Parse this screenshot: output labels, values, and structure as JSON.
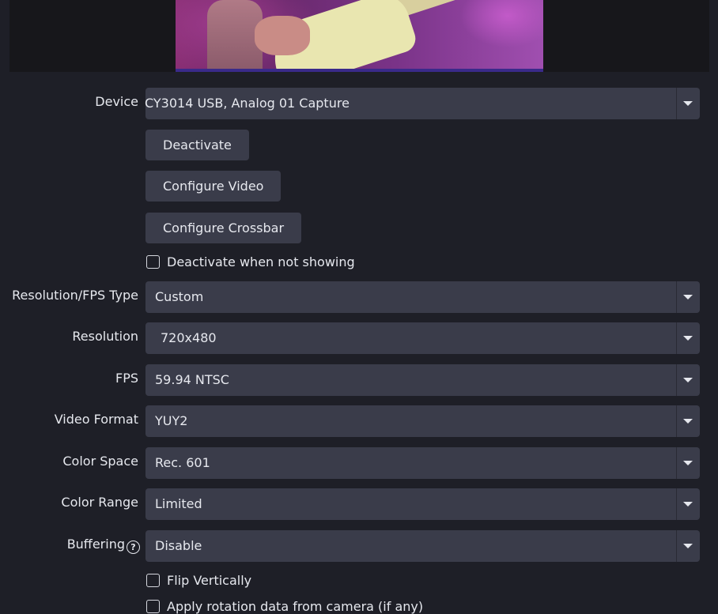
{
  "preview": {
    "description_icon": "video-preview"
  },
  "device": {
    "label": "Device",
    "value": "CY3014 USB, Analog 01 Capture"
  },
  "buttons": {
    "deactivate": "Deactivate",
    "configure_video": "Configure Video",
    "configure_crossbar": "Configure Crossbar"
  },
  "checkboxes": {
    "deactivate_when_not_showing": "Deactivate when not showing",
    "flip_vertically": "Flip Vertically",
    "apply_rotation": "Apply rotation data from camera (if any)"
  },
  "fields": {
    "res_fps_type": {
      "label": "Resolution/FPS Type",
      "value": "Custom"
    },
    "resolution": {
      "label": "Resolution",
      "value": "720x480"
    },
    "fps": {
      "label": "FPS",
      "value": "59.94 NTSC"
    },
    "video_format": {
      "label": "Video Format",
      "value": "YUY2"
    },
    "color_space": {
      "label": "Color Space",
      "value": "Rec. 601"
    },
    "color_range": {
      "label": "Color Range",
      "value": "Limited"
    },
    "buffering": {
      "label": "Buffering",
      "value": "Disable",
      "help_icon": "?"
    }
  },
  "colors": {
    "background": "#1e1f27",
    "control": "#3a3c4a",
    "text": "#e6e8ee"
  }
}
